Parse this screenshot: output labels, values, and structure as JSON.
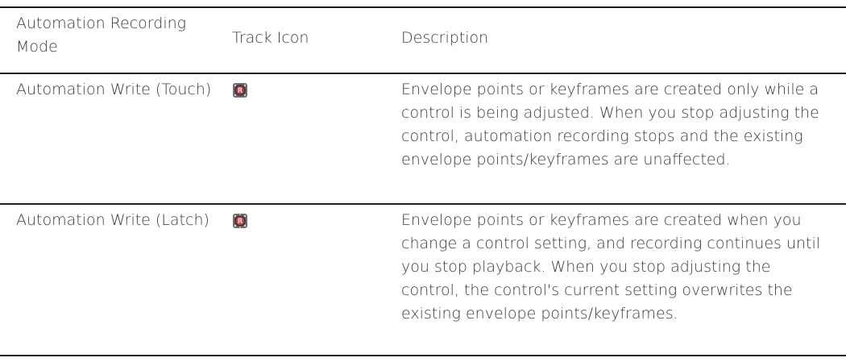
{
  "header": {
    "mode": "Automation Recording Mode",
    "icon": "Track Icon",
    "description": "Description"
  },
  "rows": [
    {
      "mode": "Automation Write (Touch)",
      "icon": "record-touch-icon",
      "description": "Envelope points or keyframes are created only while a control is being adjusted. When you stop adjusting the control, automation recording stops and the existing envelope points/keyframes are unaffected."
    },
    {
      "mode": "Automation Write (Latch)",
      "icon": "record-latch-icon",
      "description": "Envelope points or keyframes are created when you change a control setting, and recording continues until you stop playback. When you stop adjusting the control, the control's current setting overwrites the existing envelope points/keyframes."
    }
  ]
}
